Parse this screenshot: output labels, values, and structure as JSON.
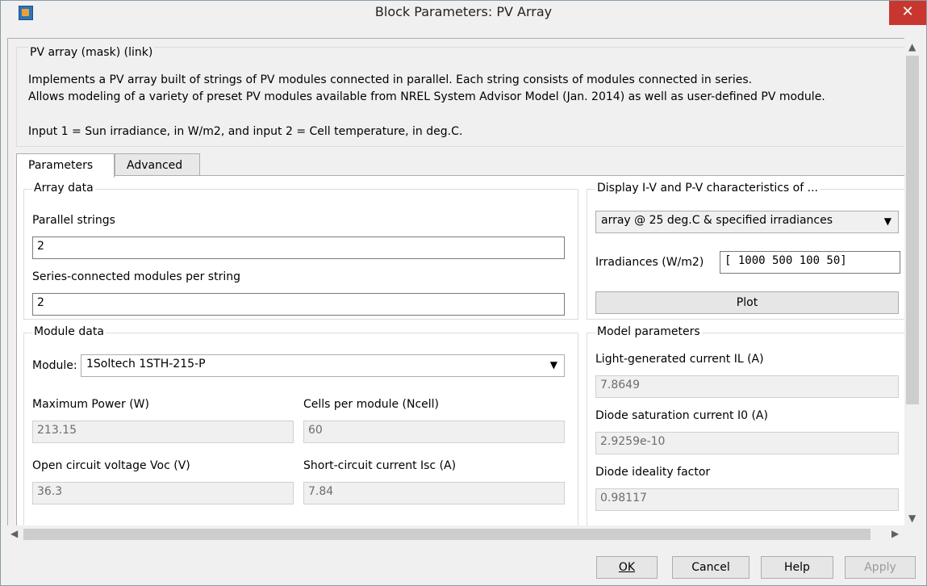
{
  "window": {
    "title": "Block Parameters: PV Array",
    "close_symbol": "✕"
  },
  "description": {
    "group_title": "PV array (mask) (link)",
    "line1": "Implements a PV array built of strings of PV modules connected in parallel. Each string consists of modules connected in series.",
    "line2": "Allows modeling of a variety of preset PV modules available from NREL System Advisor Model (Jan. 2014) as well as user-defined PV module.",
    "line3": "Input 1 = Sun irradiance, in W/m2, and input 2 = Cell temperature, in deg.C."
  },
  "tabs": [
    {
      "label": "Parameters",
      "active": true
    },
    {
      "label": "Advanced",
      "active": false
    }
  ],
  "array_data": {
    "title": "Array data",
    "parallel_label": "Parallel strings",
    "parallel_value": "2",
    "series_label": "Series-connected modules per string",
    "series_value": "2"
  },
  "display": {
    "title": "Display  I-V and P-V characteristics of ...",
    "select_value": "array @ 25 deg.C & specified irradiances",
    "irr_label": "Irradiances (W/m2)",
    "irr_value": "[ 1000  500  100  50]",
    "plot_label": "Plot"
  },
  "module_data": {
    "title": "Module data",
    "module_label": "Module:",
    "module_value": "1Soltech 1STH-215-P",
    "max_power_label": "Maximum Power (W)",
    "max_power_value": "213.15",
    "cells_label": "Cells per module (Ncell)",
    "cells_value": "60",
    "voc_label": "Open circuit voltage  Voc (V)",
    "voc_value": "36.3",
    "isc_label": "Short-circuit current Isc (A)",
    "isc_value": "7.84"
  },
  "model_params": {
    "title": "Model parameters",
    "il_label": "Light-generated current IL (A)",
    "il_value": "7.8649",
    "i0_label": "Diode saturation current I0 (A)",
    "i0_value": "2.9259e-10",
    "ideality_label": "Diode ideality factor",
    "ideality_value": "0.98117"
  },
  "buttons": {
    "ok": "OK",
    "cancel": "Cancel",
    "help": "Help",
    "apply": "Apply"
  },
  "icons": {
    "close": "close-icon",
    "app": "simulink-block-icon",
    "dropdown": "chevron-down-icon",
    "scroll_up": "chevron-up-icon",
    "scroll_down": "chevron-down-icon",
    "scroll_left": "chevron-left-icon",
    "scroll_right": "chevron-right-icon"
  },
  "colors": {
    "close_button": "#c7372f",
    "dialog_bg": "#f0f0f0",
    "panel_bg": "#ffffff"
  }
}
